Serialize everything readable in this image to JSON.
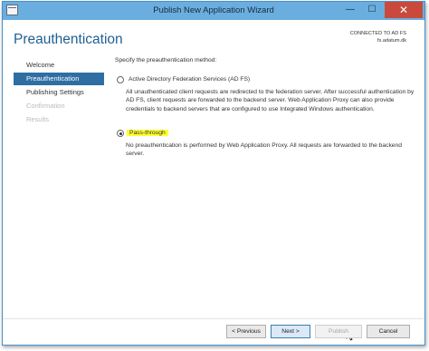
{
  "window": {
    "title": "Publish New Application Wizard",
    "min_glyph": "—",
    "max_glyph": "☐",
    "close_glyph": "✕"
  },
  "header": {
    "page_title": "Preauthentication",
    "connection_status": "CONNECTED TO AD FS",
    "server_name": "fs.adatum.dk"
  },
  "sidebar": {
    "items": [
      {
        "label": "Welcome",
        "state": "normal"
      },
      {
        "label": "Preauthentication",
        "state": "active"
      },
      {
        "label": "Publishing Settings",
        "state": "normal"
      },
      {
        "label": "Confirmation",
        "state": "disabled"
      },
      {
        "label": "Results",
        "state": "disabled"
      }
    ]
  },
  "content": {
    "instruction": "Specify the preauthentication method:",
    "options": [
      {
        "label": "Active Directory Federation Services (AD FS)",
        "selected": false,
        "description": "All unauthenticated client requests are redirected to the federation server. After successful authentication by AD FS, client requests are forwarded to the backend server. Web Application Proxy can also provide credentials to backend servers that are configured to use Integrated Windows authentication."
      },
      {
        "label": "Pass-through",
        "selected": true,
        "highlighted": true,
        "description": "No preauthentication is performed by Web Application Proxy. All requests are forwarded to the backend server."
      }
    ]
  },
  "footer": {
    "previous_label": "< Previous",
    "next_label": "Next >",
    "publish_label": "Publish",
    "cancel_label": "Cancel"
  },
  "colors": {
    "titlebar": "#6aaee0",
    "accent": "#1f5f94",
    "nav_active": "#2f6ea3",
    "highlight": "#ffff33",
    "close_button": "#c94a3d"
  },
  "icons": {
    "app": "app-window-icon",
    "cursor": "mouse-pointer-icon"
  }
}
